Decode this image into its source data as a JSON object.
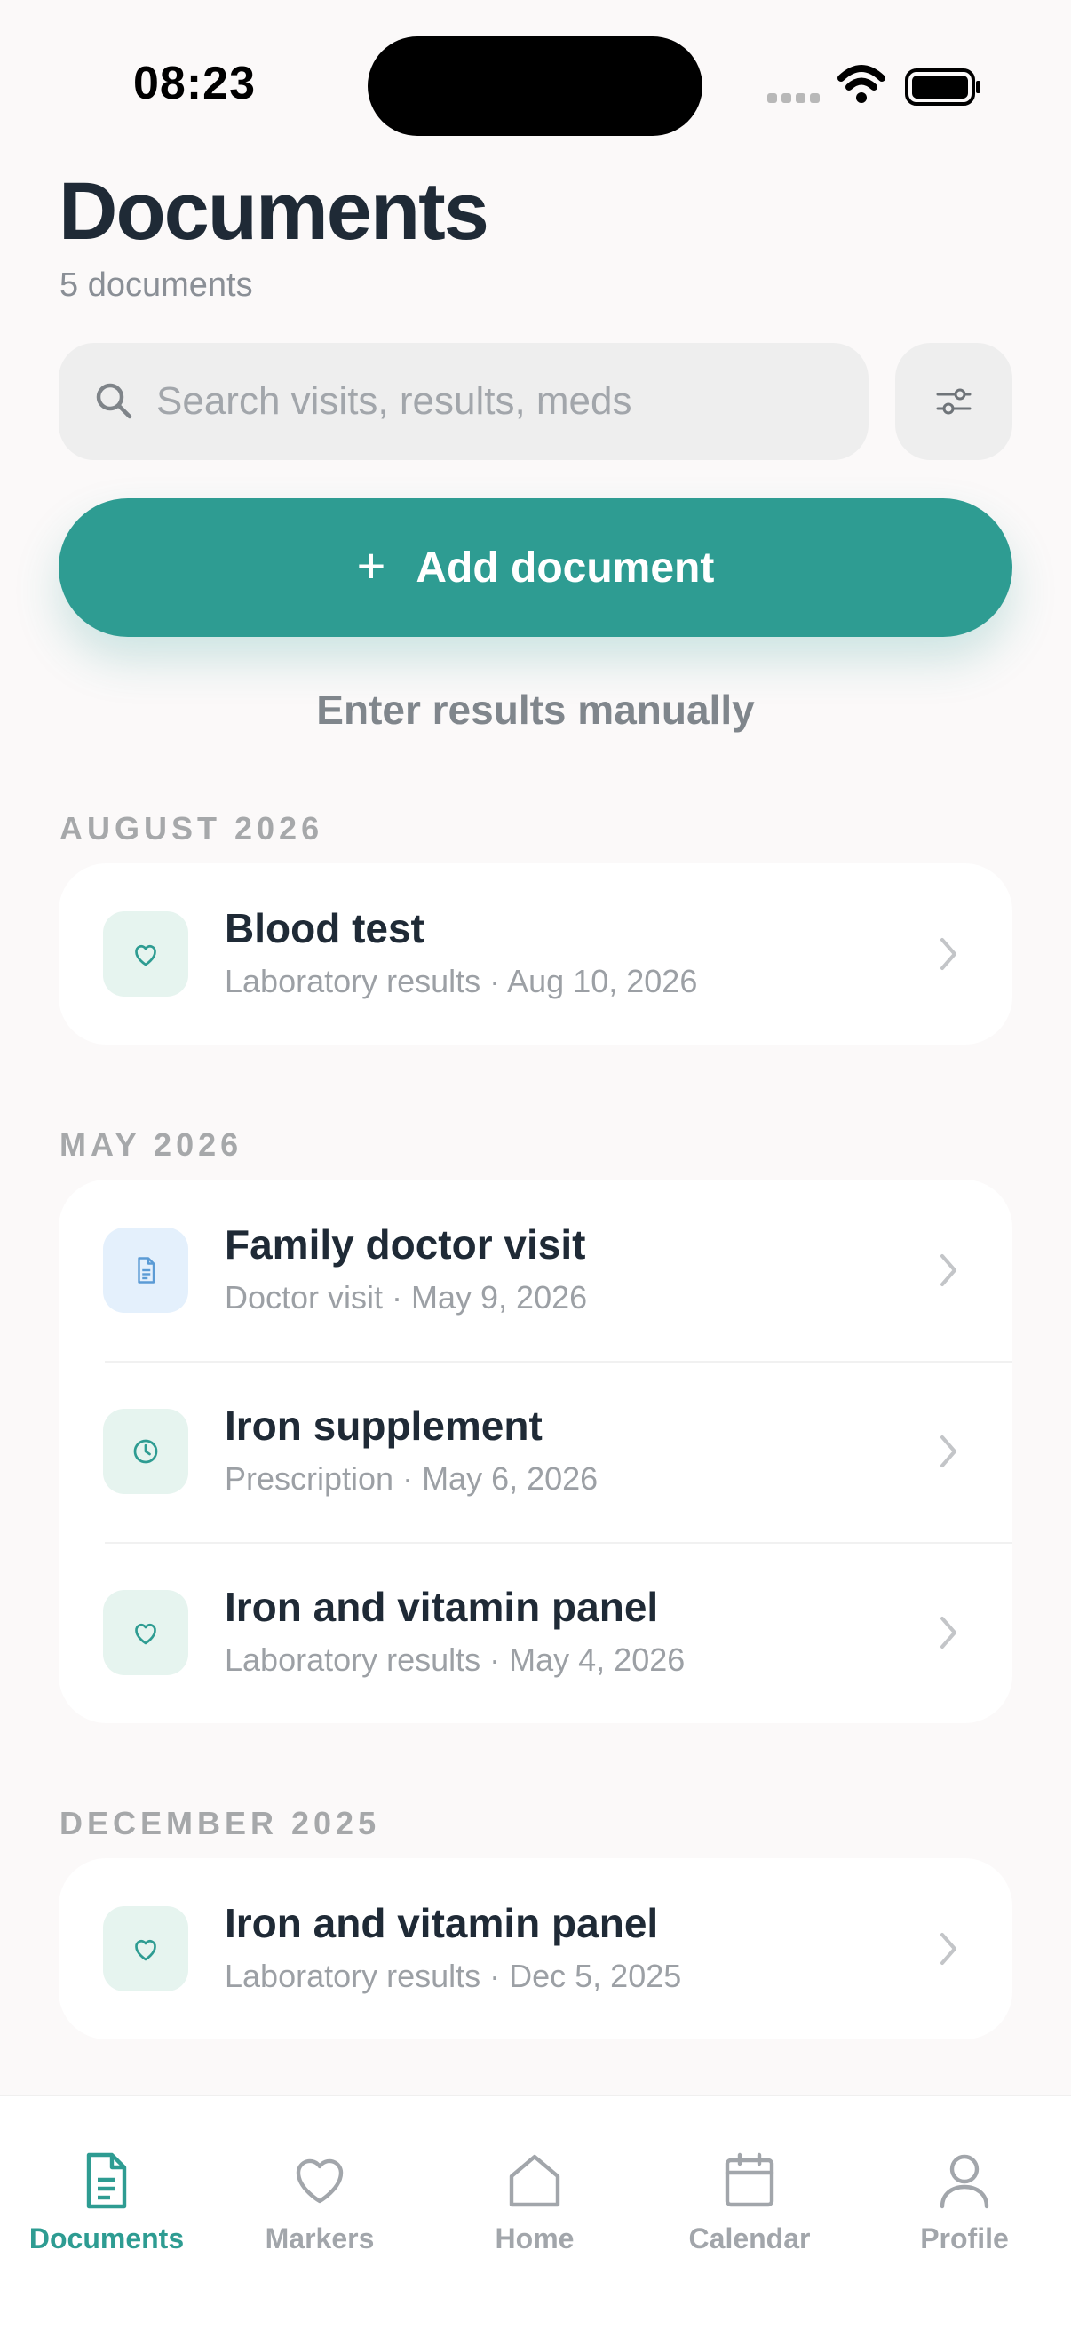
{
  "status_bar": {
    "time": "08:23"
  },
  "header": {
    "title": "Documents",
    "subtitle": "5 documents"
  },
  "search": {
    "placeholder": "Search visits, results, meds"
  },
  "actions": {
    "add_label": "Add document",
    "manual_label": "Enter results manually"
  },
  "colors": {
    "accent": "#2e9c92",
    "lab_badge": "#e6f4ef",
    "visit_badge": "#e4f0fc"
  },
  "sections": [
    {
      "label": "AUGUST 2026",
      "items": [
        {
          "icon": "heart-icon",
          "title": "Blood test",
          "meta": "Laboratory results · Aug 10, 2026"
        }
      ]
    },
    {
      "label": "MAY 2026",
      "items": [
        {
          "icon": "document-icon",
          "title": "Family doctor visit",
          "meta": "Doctor visit · May 9, 2026"
        },
        {
          "icon": "clock-icon",
          "title": "Iron supplement",
          "meta": "Prescription · May 6, 2026"
        },
        {
          "icon": "heart-icon",
          "title": "Iron and vitamin panel",
          "meta": "Laboratory results · May 4, 2026"
        }
      ]
    },
    {
      "label": "DECEMBER 2025",
      "items": [
        {
          "icon": "heart-icon",
          "title": "Iron and vitamin panel",
          "meta": "Laboratory results · Dec 5, 2025"
        }
      ]
    }
  ],
  "tabbar": {
    "items": [
      {
        "label": "Documents",
        "icon": "document-icon",
        "active": true
      },
      {
        "label": "Markers",
        "icon": "heart-icon",
        "active": false
      },
      {
        "label": "Home",
        "icon": "home-icon",
        "active": false
      },
      {
        "label": "Calendar",
        "icon": "calendar-icon",
        "active": false
      },
      {
        "label": "Profile",
        "icon": "person-icon",
        "active": false
      }
    ]
  }
}
